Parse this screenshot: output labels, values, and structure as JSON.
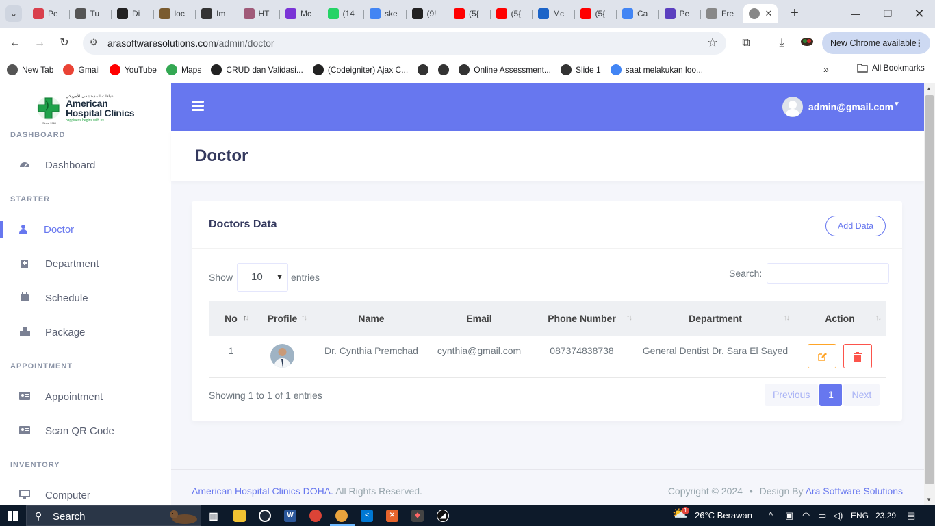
{
  "browser": {
    "tabs": [
      {
        "title": "Pe",
        "color": "#d93f4c"
      },
      {
        "title": "Tu",
        "color": "#555555"
      },
      {
        "title": "Di",
        "color": "#222222"
      },
      {
        "title": "loc",
        "color": "#7a5b2f"
      },
      {
        "title": "Im",
        "color": "#333333"
      },
      {
        "title": "HT",
        "color": "#a05a78"
      },
      {
        "title": "Mc",
        "color": "#7a34d6"
      },
      {
        "title": "(14",
        "color": "#25d366"
      },
      {
        "title": "ske",
        "color": "#4285f4"
      },
      {
        "title": "(9!",
        "color": "#222222"
      },
      {
        "title": "(5{",
        "color": "#ff0000"
      },
      {
        "title": "(5{",
        "color": "#ff0000"
      },
      {
        "title": "Mc",
        "color": "#1c64c8"
      },
      {
        "title": "(5{",
        "color": "#ff0000"
      },
      {
        "title": "Ca",
        "color": "#4285f4"
      },
      {
        "title": "Pe",
        "color": "#5b3fbf"
      },
      {
        "title": "Fre",
        "color": "#888888"
      }
    ],
    "url_host": "arasoftwaresolutions.com",
    "url_path": "/admin/doctor",
    "update_label": "New Chrome available",
    "bookmarks": [
      {
        "label": "New Tab",
        "icon": "globe-icon",
        "color": "#555555"
      },
      {
        "label": "Gmail",
        "icon": "gmail-icon",
        "color": "#ea4335"
      },
      {
        "label": "YouTube",
        "icon": "youtube-icon",
        "color": "#ff0000"
      },
      {
        "label": "Maps",
        "icon": "maps-icon",
        "color": "#34a853"
      },
      {
        "label": "CRUD dan Validasi...",
        "icon": "site-icon",
        "color": "#222222"
      },
      {
        "label": "(Codeigniter) Ajax C...",
        "icon": "site-icon",
        "color": "#222222"
      },
      {
        "label": "",
        "icon": "globe-icon",
        "color": "#333333"
      },
      {
        "label": "",
        "icon": "globe-icon",
        "color": "#333333"
      },
      {
        "label": "Online Assessment...",
        "icon": "globe-icon",
        "color": "#333333"
      },
      {
        "label": "Slide 1",
        "icon": "globe-icon",
        "color": "#333333"
      },
      {
        "label": "saat melakukan loo...",
        "icon": "google-icon",
        "color": "#4285f4"
      }
    ],
    "all_bookmarks": "All Bookmarks"
  },
  "logo": {
    "arabic": "عيادات المستشفى الأمريكي",
    "title_line1": "American",
    "title_line2": "Hospital Clinics",
    "tagline": "happiness begins with us...",
    "since": "Since 1969"
  },
  "sidebar": {
    "sections": [
      {
        "label": "DASHBOARD"
      },
      {
        "label": "STARTER"
      },
      {
        "label": "APPOINTMENT"
      },
      {
        "label": "INVENTORY"
      }
    ],
    "items": [
      {
        "label": "Dashboard",
        "icon": "dashboard-gauge-icon"
      },
      {
        "label": "Doctor",
        "icon": "user-md-icon",
        "active": true
      },
      {
        "label": "Department",
        "icon": "hospital-icon"
      },
      {
        "label": "Schedule",
        "icon": "calendar-icon"
      },
      {
        "label": "Package",
        "icon": "boxes-icon"
      },
      {
        "label": "Appointment",
        "icon": "id-card-icon"
      },
      {
        "label": "Scan QR Code",
        "icon": "id-card-icon"
      },
      {
        "label": "Computer",
        "icon": "desktop-icon"
      }
    ]
  },
  "topnav": {
    "user_email": "admin@gmail.com"
  },
  "page": {
    "title": "Doctor",
    "card_title": "Doctors Data",
    "add_button": "Add Data",
    "show_label": "Show",
    "entries_value": "10",
    "entries_label": "entries",
    "search_label": "Search:",
    "search_value": "",
    "columns": [
      "No",
      "Profile",
      "Name",
      "Email",
      "Phone Number",
      "Department",
      "Action"
    ],
    "rows": [
      {
        "no": "1",
        "name": "Dr. Cynthia Premchad",
        "email": "cynthia@gmail.com",
        "phone": "087374838738",
        "department": "General Dentist Dr. Sara El Sayed"
      }
    ],
    "info": "Showing 1 to 1 of 1 entries",
    "pager": {
      "previous": "Previous",
      "current": "1",
      "next": "Next"
    }
  },
  "footer": {
    "org": "American Hospital Clinics DOHA.",
    "rights": "All Rights Reserved.",
    "copyright": "Copyright © 2024",
    "bullet": "•",
    "design_by": "Design By",
    "designer": "Ara Software Solutions"
  },
  "taskbar": {
    "search_placeholder": "Search",
    "weather": "26°C Berawan",
    "weather_badge": "1",
    "language": "ENG",
    "time": "23.29"
  },
  "colors": {
    "primary": "#6777ef",
    "warning": "#ffa426",
    "danger": "#fc544b"
  }
}
